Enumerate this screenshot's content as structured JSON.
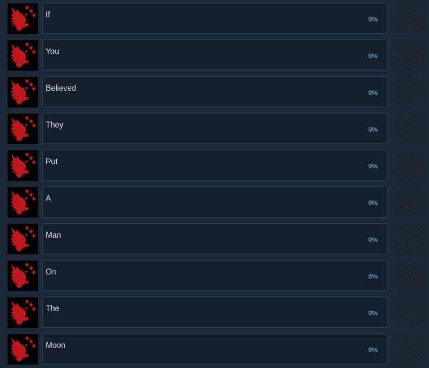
{
  "achievements": [
    {
      "name": "If",
      "percent": "0%",
      "icon": "red-wolf-icon"
    },
    {
      "name": "You",
      "percent": "0%",
      "icon": "red-wolf-icon"
    },
    {
      "name": "Believed",
      "percent": "0%",
      "icon": "red-wolf-icon"
    },
    {
      "name": "They",
      "percent": "0%",
      "icon": "red-wolf-icon"
    },
    {
      "name": "Put",
      "percent": "0%",
      "icon": "red-wolf-icon"
    },
    {
      "name": "A",
      "percent": "0%",
      "icon": "red-wolf-icon"
    },
    {
      "name": "Man",
      "percent": "0%",
      "icon": "red-wolf-icon"
    },
    {
      "name": "On",
      "percent": "0%",
      "icon": "red-wolf-icon"
    },
    {
      "name": "The",
      "percent": "0%",
      "icon": "red-wolf-icon"
    },
    {
      "name": "Moon",
      "percent": "0%",
      "icon": "red-wolf-icon"
    }
  ],
  "colors": {
    "background": "#1b2838",
    "card": "#16202d",
    "card_border": "#2a3f5a",
    "name_text": "#d6d7d8",
    "percent_text": "#57a0d3",
    "icon_red": "#c0171d"
  }
}
